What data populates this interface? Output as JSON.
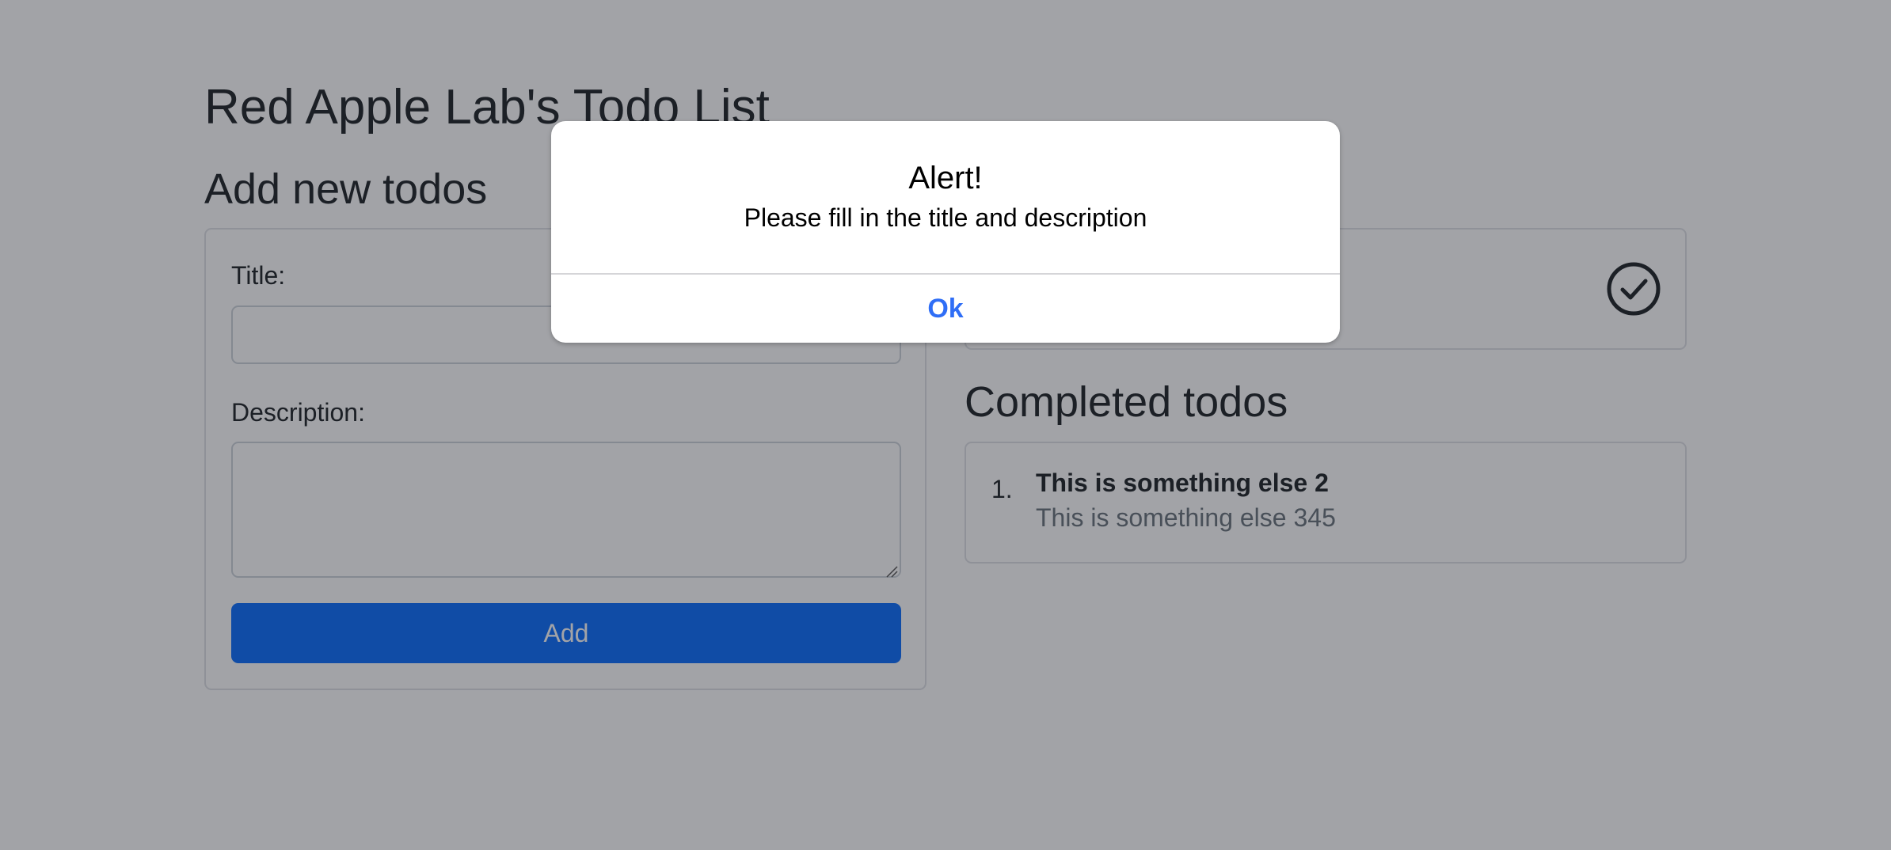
{
  "app": {
    "title": "Red Apple Lab's Todo List"
  },
  "add_section": {
    "heading": "Add new todos",
    "title_label": "Title:",
    "title_value": "",
    "description_label": "Description:",
    "description_value": "",
    "add_button_label": "Add"
  },
  "pending_section": {
    "complete_icon": "check-circle-icon"
  },
  "completed_section": {
    "heading": "Completed todos",
    "items": [
      {
        "number": "1.",
        "title": "This is something else 2",
        "description": "This is something else 345"
      }
    ]
  },
  "alert": {
    "title": "Alert!",
    "message": "Please fill in the title and description",
    "ok_label": "Ok"
  },
  "colors": {
    "primary": "#0d6efd",
    "alert_action": "#2f6ef6",
    "overlay": "rgba(22,26,34,0.40)"
  }
}
